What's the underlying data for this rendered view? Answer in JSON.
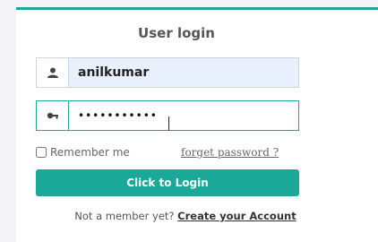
{
  "login": {
    "title": "User login",
    "username_value": "anilkumar",
    "password_value": "•••••••••••",
    "remember_label": "Remember me",
    "forgot_label": "forget password ?",
    "submit_label": "Click to Login",
    "register_prompt": "Not a member yet?",
    "register_link": "Create your Account"
  },
  "icons": {
    "user": "user-icon",
    "password": "key-icon"
  },
  "colors": {
    "accent": "#1aa999",
    "autofill_bg": "#e8f0fe"
  }
}
